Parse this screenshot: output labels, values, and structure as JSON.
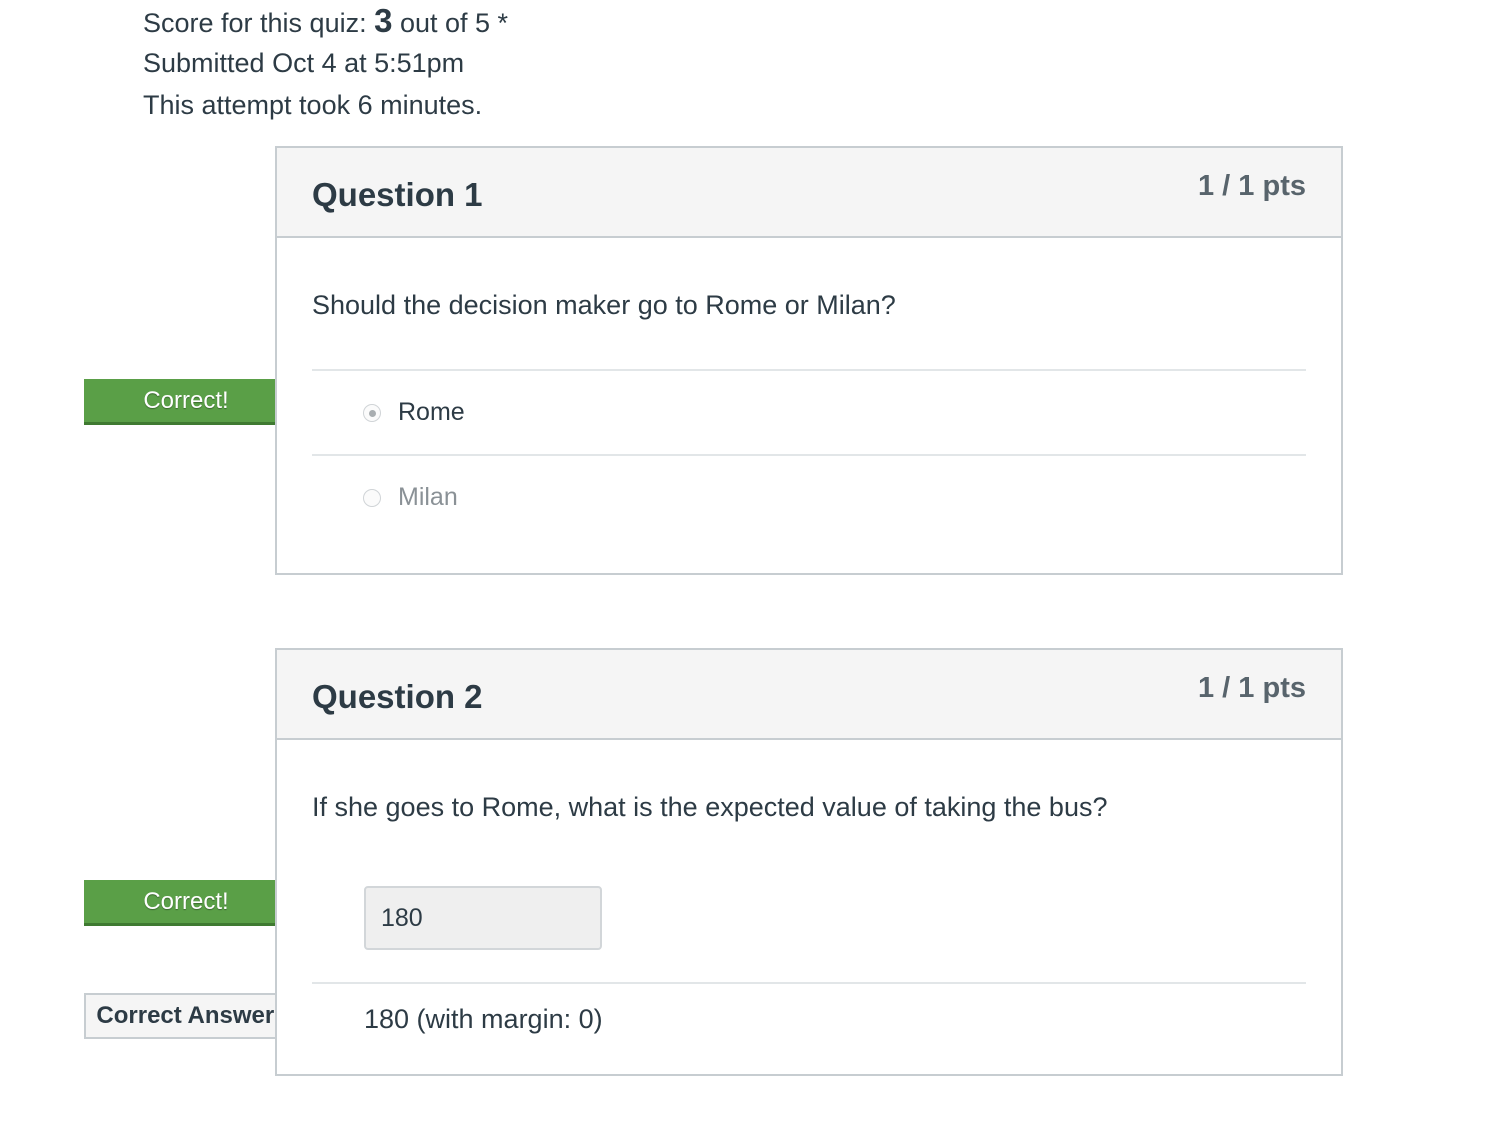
{
  "summary": {
    "score_prefix": "Score for this quiz: ",
    "score_value": "3",
    "score_suffix": " out of 5 *",
    "submitted": "Submitted Oct 4 at 5:51pm",
    "duration": "This attempt took 6 minutes."
  },
  "questions": [
    {
      "title": "Question 1",
      "points": "1 / 1 pts",
      "prompt": "Should the decision maker go to Rome or Milan?",
      "flag": "Correct!",
      "answers": [
        {
          "label": "Rome",
          "selected": true
        },
        {
          "label": "Milan",
          "selected": false
        }
      ]
    },
    {
      "title": "Question 2",
      "points": "1 / 1 pts",
      "prompt": "If she goes to Rome, what is the expected value of taking the bus?",
      "flag": "Correct!",
      "answer_value": "180",
      "correct_answers_flag": "Correct Answers",
      "correct_answer_text": "180 (with margin: 0)"
    }
  ],
  "colors": {
    "correct_flag": "#5a9f47",
    "text": "#2d3b45",
    "border": "#c7cdd1"
  }
}
